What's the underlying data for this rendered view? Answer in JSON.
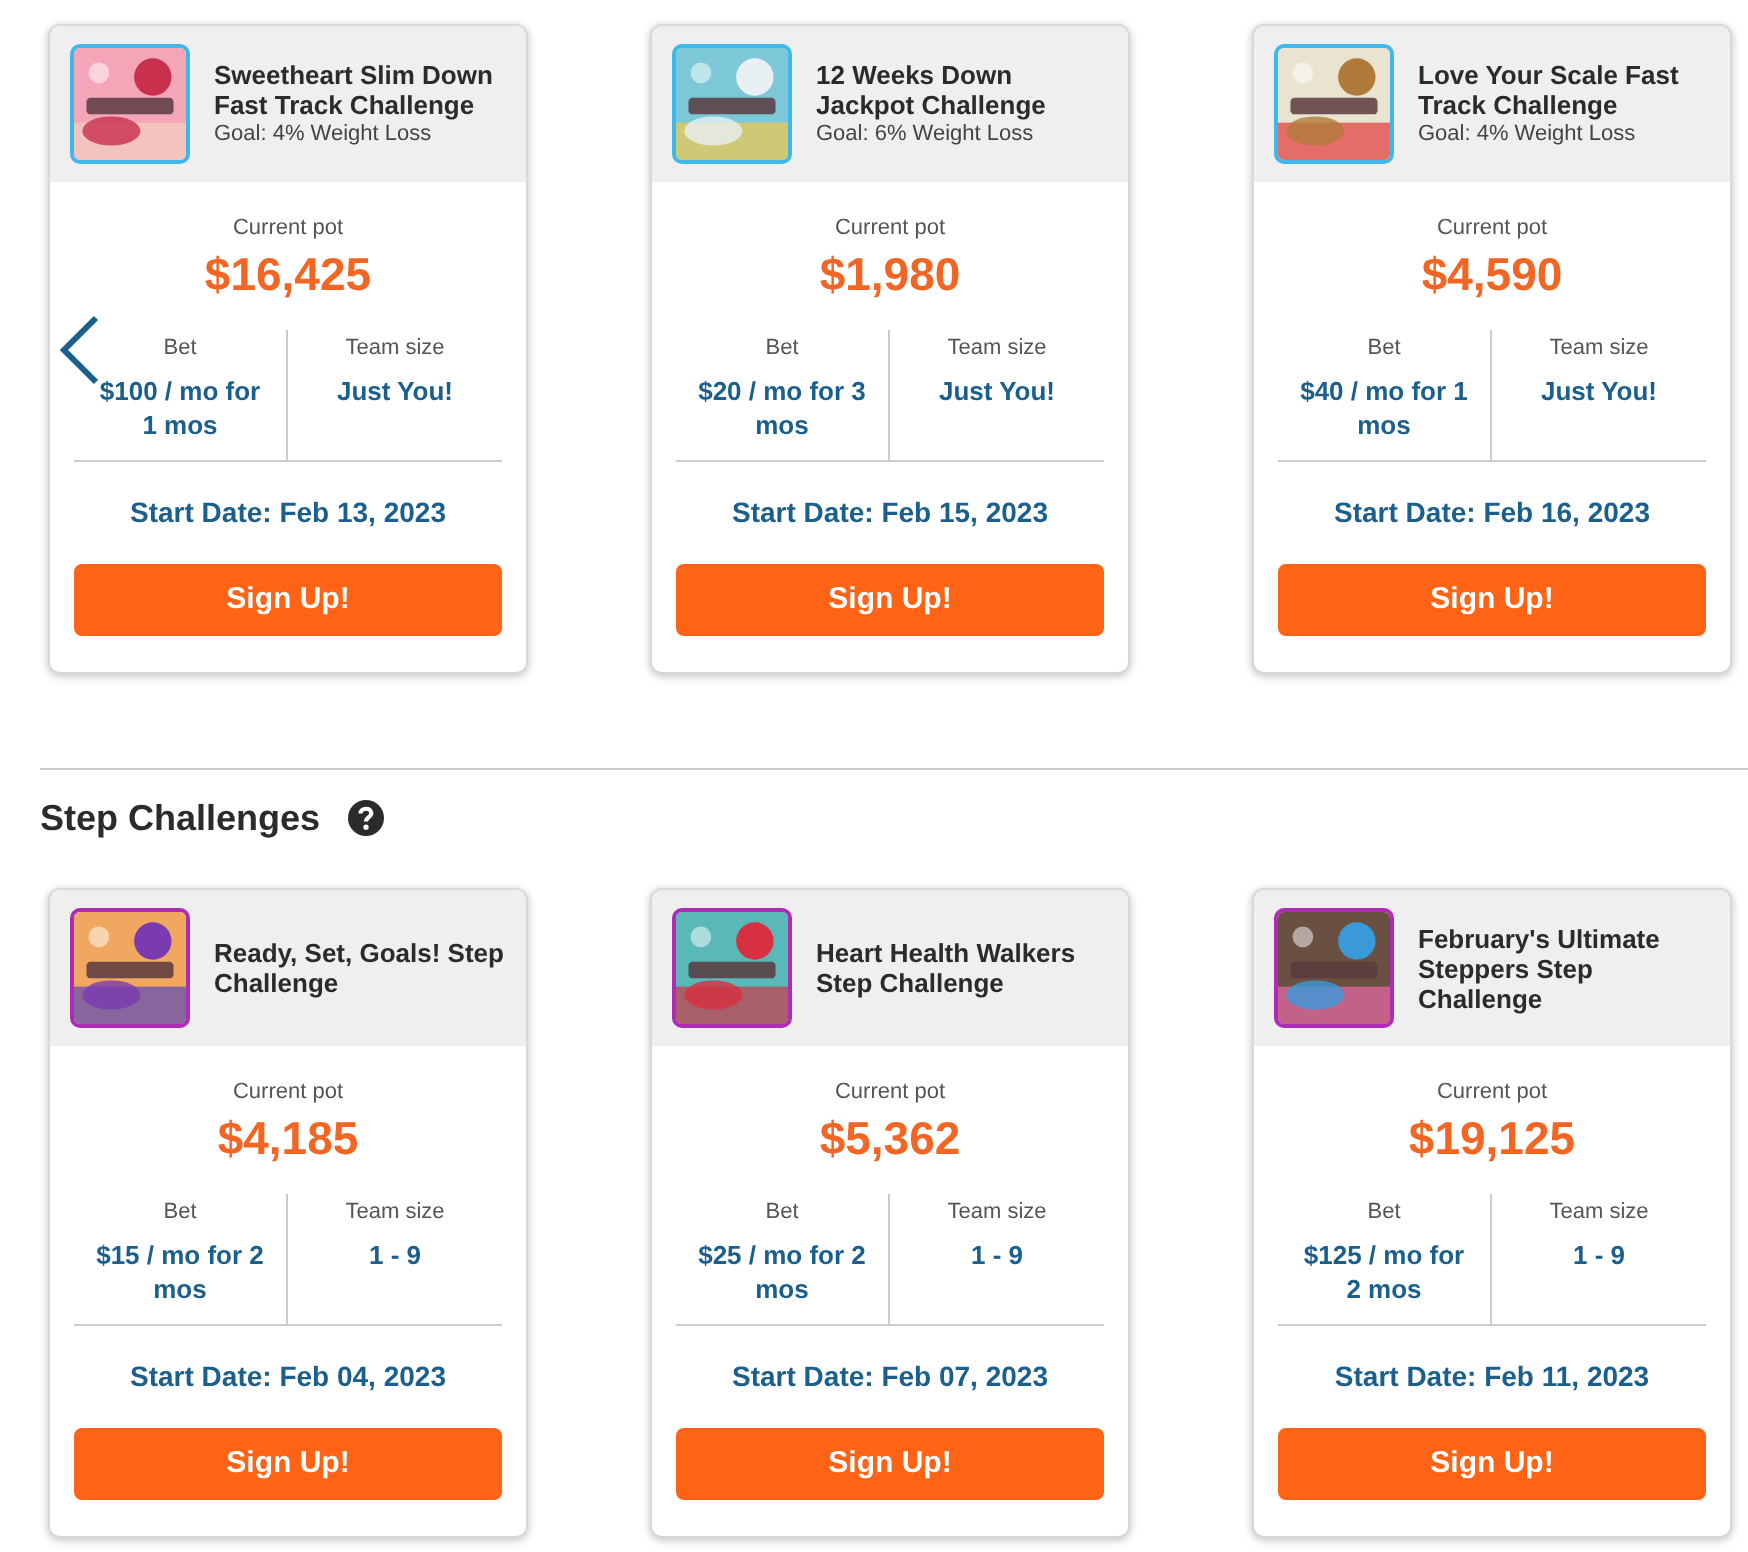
{
  "weight_loss_challenges": {
    "kind": "weight",
    "cards": [
      {
        "title": "Sweetheart Slim Down Fast Track Challenge",
        "goal": "Goal: 4% Weight Loss",
        "pot_label": "Current pot",
        "pot": "$16,425",
        "bet_label": "Bet",
        "bet": "$100 / mo for 1 mos",
        "team_label": "Team size",
        "team": "Just You!",
        "start": "Start Date: Feb 13, 2023",
        "button": "Sign Up!"
      },
      {
        "title": "12 Weeks Down Jackpot Challenge",
        "goal": "Goal: 6% Weight Loss",
        "pot_label": "Current pot",
        "pot": "$1,980",
        "bet_label": "Bet",
        "bet": "$20 / mo for 3 mos",
        "team_label": "Team size",
        "team": "Just You!",
        "start": "Start Date: Feb 15, 2023",
        "button": "Sign Up!"
      },
      {
        "title": "Love Your Scale Fast Track Challenge",
        "goal": "Goal: 4% Weight Loss",
        "pot_label": "Current pot",
        "pot": "$4,590",
        "bet_label": "Bet",
        "bet": "$40 / mo for 1 mos",
        "team_label": "Team size",
        "team": "Just You!",
        "start": "Start Date: Feb 16, 2023",
        "button": "Sign Up!"
      }
    ]
  },
  "step_challenges": {
    "kind": "step",
    "heading": "Step Challenges",
    "cards": [
      {
        "title": "Ready, Set, Goals! Step Challenge",
        "pot_label": "Current pot",
        "pot": "$4,185",
        "bet_label": "Bet",
        "bet": "$15 / mo for 2 mos",
        "team_label": "Team size",
        "team": "1 - 9",
        "start": "Start Date: Feb 04, 2023",
        "button": "Sign Up!"
      },
      {
        "title": "Heart Health Walkers Step Challenge",
        "pot_label": "Current pot",
        "pot": "$5,362",
        "bet_label": "Bet",
        "bet": "$25 / mo for 2 mos",
        "team_label": "Team size",
        "team": "1 - 9",
        "start": "Start Date: Feb 07, 2023",
        "button": "Sign Up!"
      },
      {
        "title": "February's Ultimate Steppers Step Challenge",
        "pot_label": "Current pot",
        "pot": "$19,125",
        "bet_label": "Bet",
        "bet": "$125 / mo for 2 mos",
        "team_label": "Team size",
        "team": "1 - 9",
        "start": "Start Date: Feb 11, 2023",
        "button": "Sign Up!"
      }
    ]
  }
}
